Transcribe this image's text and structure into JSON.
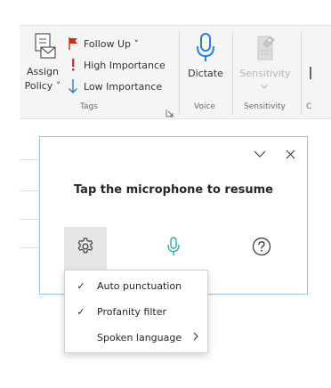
{
  "ribbon": {
    "tags_group": {
      "assign_policy_label_line1": "Assign",
      "assign_policy_label_line2": "Policy ˅",
      "follow_up_label": "Follow Up ˅",
      "high_importance_label": "High Importance",
      "low_importance_label": "Low Importance",
      "group_label": "Tags"
    },
    "voice_group": {
      "dictate_label": "Dictate",
      "group_label": "Voice"
    },
    "sensitivity_group": {
      "sensitivity_label": "Sensitivity",
      "group_label": "Sensitivity"
    },
    "overflow_group_label_fragment": "C"
  },
  "dialog": {
    "message": "Tap the microphone to resume",
    "icons": {
      "collapse": "chevron-down-icon",
      "close": "close-icon",
      "settings": "gear-icon",
      "microphone": "microphone-icon",
      "help": "help-icon"
    }
  },
  "settings_menu": {
    "items": [
      {
        "label": "Auto punctuation",
        "checked": true
      },
      {
        "label": "Profanity filter",
        "checked": true
      },
      {
        "label": "Spoken language",
        "checked": false,
        "has_submenu": true
      }
    ],
    "check_glyph": "✓"
  },
  "colors": {
    "flag_red": "#c42b1c",
    "importance_red": "#d13438",
    "low_importance_blue": "#2b7cd3",
    "mic_blue": "#2f7fd6",
    "dialog_mic_teal": "#2aa7a2",
    "dialog_border": "#9cc4de",
    "disabled_gray": "#b4b4b4"
  }
}
